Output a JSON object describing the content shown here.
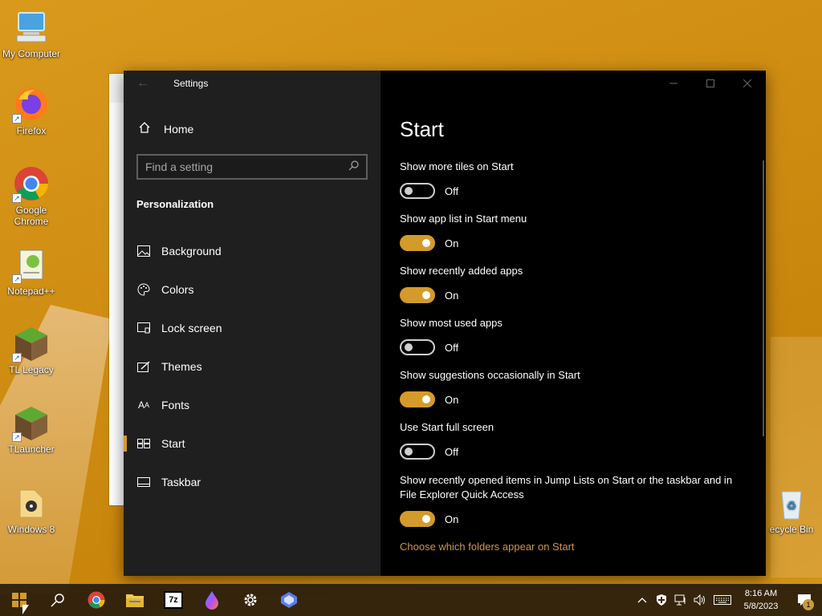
{
  "desktop": {
    "icons": [
      {
        "label": "My Computer",
        "icon": "computer-icon"
      },
      {
        "label": "Firefox",
        "icon": "firefox-icon"
      },
      {
        "label": "Google Chrome",
        "icon": "chrome-icon"
      },
      {
        "label": "Notepad++",
        "icon": "notepadpp-icon"
      },
      {
        "label": "TL Legacy",
        "icon": "minecraft-icon"
      },
      {
        "label": "TLauncher",
        "icon": "minecraft-icon"
      },
      {
        "label": "Windows 8",
        "icon": "folder-icon"
      },
      {
        "label": "ecycle Bin",
        "icon": "recycle-bin-icon"
      }
    ]
  },
  "settings": {
    "title": "Settings",
    "nav": {
      "home_label": "Home",
      "search_placeholder": "Find a setting",
      "section": "Personalization",
      "items": [
        {
          "label": "Background",
          "icon": "picture-icon"
        },
        {
          "label": "Colors",
          "icon": "palette-icon"
        },
        {
          "label": "Lock screen",
          "icon": "lock-screen-icon"
        },
        {
          "label": "Themes",
          "icon": "brush-icon"
        },
        {
          "label": "Fonts",
          "icon": "fonts-icon"
        },
        {
          "label": "Start",
          "icon": "start-icon",
          "active": true
        },
        {
          "label": "Taskbar",
          "icon": "taskbar-icon"
        }
      ]
    },
    "page": {
      "title": "Start",
      "settings": [
        {
          "label": "Show more tiles on Start",
          "state": "Off"
        },
        {
          "label": "Show app list in Start menu",
          "state": "On"
        },
        {
          "label": "Show recently added apps",
          "state": "On"
        },
        {
          "label": "Show most used apps",
          "state": "Off"
        },
        {
          "label": "Show suggestions occasionally in Start",
          "state": "On"
        },
        {
          "label": "Use Start full screen",
          "state": "Off"
        },
        {
          "label": "Show recently opened items in Jump Lists on Start or the taskbar and in File Explorer Quick Access",
          "state": "On"
        }
      ],
      "link": "Choose which folders appear on Start"
    },
    "accent_color": "#d49a2a"
  },
  "taskbar": {
    "apps": [
      "windows-start-icon",
      "search-icon",
      "chrome-icon",
      "file-explorer-icon",
      "7zip-icon",
      "paint-drop-icon",
      "settings-gear-icon",
      "copilot-icon"
    ],
    "seven_zip_label": "7z",
    "clock": {
      "time": "8:16 AM",
      "date": "5/8/2023"
    },
    "notifications_count": "1"
  }
}
